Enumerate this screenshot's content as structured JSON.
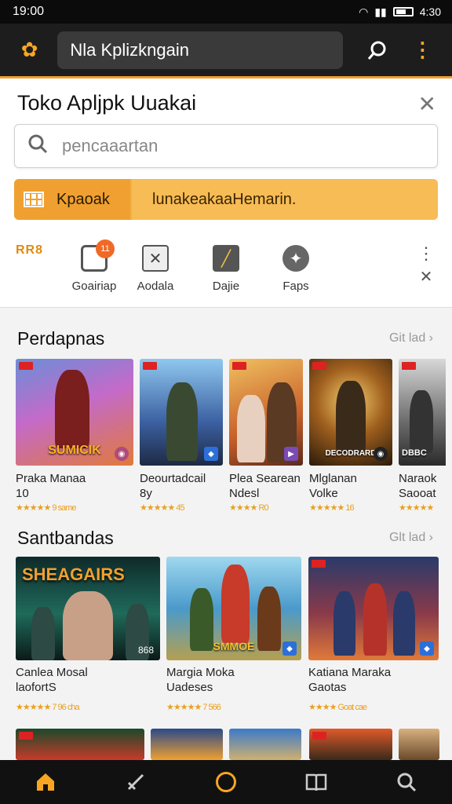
{
  "status": {
    "time": "19:00",
    "right_time": "4:30"
  },
  "appbar": {
    "search_text": "Nla Kplizkngain"
  },
  "sheet": {
    "title": "Toko Apljpk Uuakai",
    "search_placeholder": "pencaaartan",
    "tab_left": "Kpaoak",
    "tab_right": "lunakeakaaHemarin."
  },
  "categories": {
    "badge": "RR8",
    "items": [
      {
        "label": "Goairiap",
        "notif": "11",
        "icon": "message-icon"
      },
      {
        "label": "Aodala",
        "icon": "crossed-swords-icon"
      },
      {
        "label": "Dajie",
        "icon": "sword-icon"
      },
      {
        "label": "Faps",
        "icon": "puzzle-icon"
      }
    ]
  },
  "section1": {
    "title": "Perdapnas",
    "see_all": "Git lad",
    "cards": [
      {
        "thumb_title": "SUMICIK",
        "name1": "Praka Manaa",
        "name2": "10",
        "rating": "★★★★★ 9 same",
        "accent": "#8a5bc9"
      },
      {
        "thumb_title": "",
        "name1": "Deourtadcail",
        "name2": "8y",
        "rating": "★★★★★ 45",
        "accent": "#3a6fb5"
      },
      {
        "thumb_title": "",
        "name1": "Plea Searean",
        "name2": "Ndesl",
        "rating": "★★★★ R0",
        "accent": "#c55a2a"
      },
      {
        "thumb_title": "DECODRARD",
        "name1": "Mlglanan",
        "name2": "Volke",
        "rating": "★★★★★ 16",
        "accent": "#6a4a1a"
      },
      {
        "thumb_title": "DBBC",
        "name1": "Naraok",
        "name2": "Saooat",
        "rating": "★★★★★",
        "accent": "#555"
      }
    ]
  },
  "section2": {
    "title": "Santbandas",
    "see_all": "Glt lad",
    "cards": [
      {
        "thumb_title": "SHEAGAIRS",
        "num": "868",
        "name1": "Canlea Mosal",
        "name2": "laofortS",
        "rating": "★★★★★ 7 96 cha",
        "accent": "#1f6a5a"
      },
      {
        "thumb_title": "SMMOE",
        "name1": "Margia Moka",
        "name2": "Uadeses",
        "rating": "★★★★★ 7 566",
        "accent": "#3b9ac9"
      },
      {
        "thumb_title": "",
        "name1": "Katiana Maraka",
        "name2": "Gaotas",
        "rating": "★★★★ Goat cae",
        "accent": "#b5322a"
      }
    ]
  },
  "nav": {
    "items": [
      {
        "icon": "home-icon"
      },
      {
        "icon": "sword-icon"
      },
      {
        "icon": "games-ring-icon"
      },
      {
        "icon": "book-icon"
      },
      {
        "icon": "search-icon"
      }
    ]
  }
}
